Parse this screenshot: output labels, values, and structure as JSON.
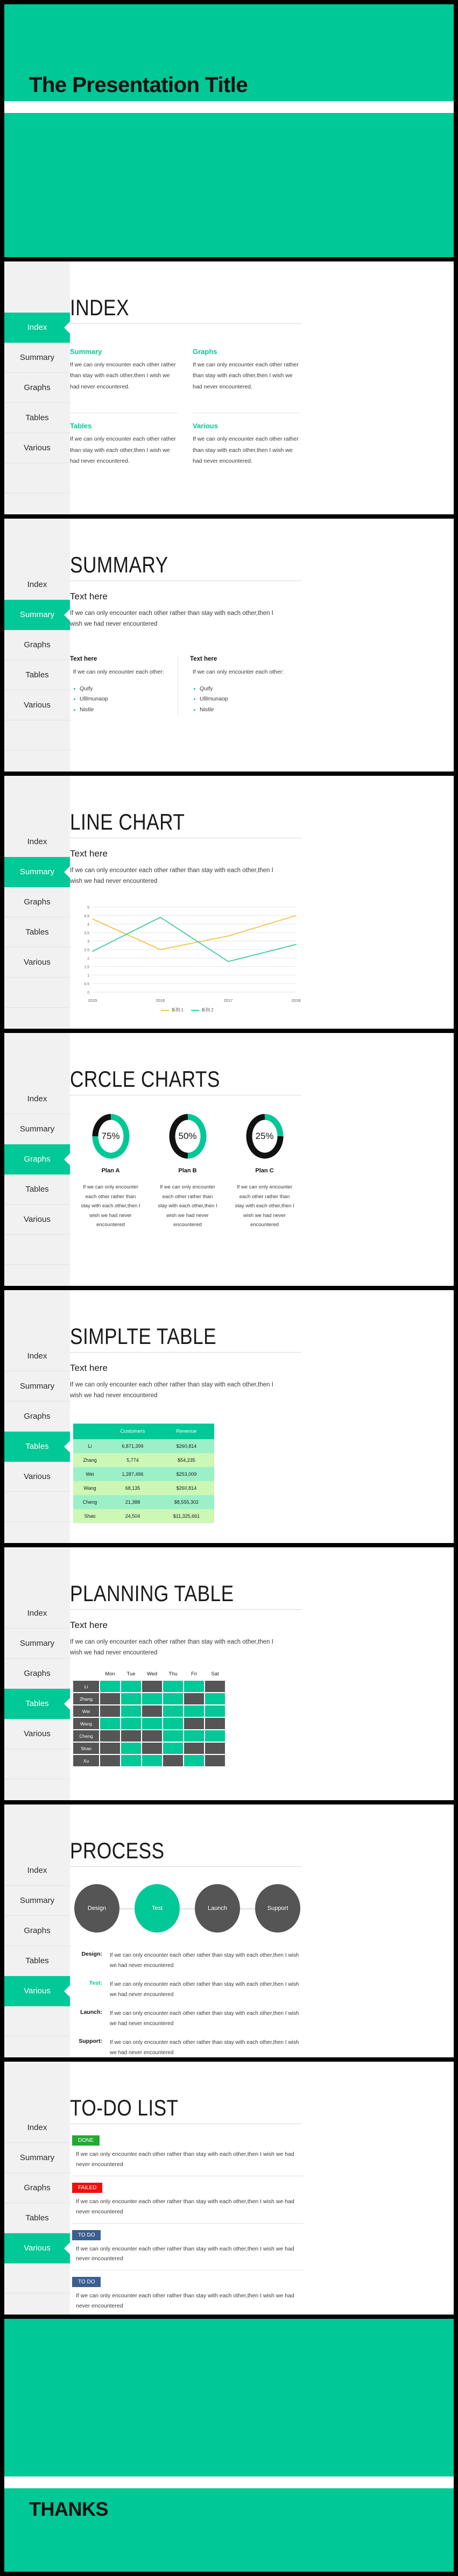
{
  "theme": {
    "accent": "#00c896",
    "dark_gray": "#555555",
    "sidebar_bg": "#f1f1f1",
    "done_green": "#22aa33",
    "failed_red": "#ee1111",
    "todo_blue": "#3b5f8f",
    "series1_color": "#f2c14e",
    "series2_color": "#3fc9a3"
  },
  "lorem": "If we can only encounter each other rather than stay with each other,then I wish we had never encountered",
  "lorem_short": "If we can only encounter each other rather than stay with each other,then I wish we had never encountered.",
  "nav": {
    "items": [
      "Index",
      "Summary",
      "Graphs",
      "Tables",
      "Various"
    ]
  },
  "cover": {
    "title": "The Presentation Title"
  },
  "closing": {
    "title": "THANKS"
  },
  "index": {
    "title": "INDEX",
    "cards": [
      {
        "heading": "Summary",
        "text": "If we can only encounter each other rather than stay with each other,then I wish we had never encountered."
      },
      {
        "heading": "Graphs",
        "text": "If we can only encounter each other rather than stay with each other,then I wish we had never encountered."
      },
      {
        "heading": "Tables",
        "text": "If we can only encounter each other rather than stay with each other,then I wish we had never encountered."
      },
      {
        "heading": "Various",
        "text": "If we can only encounter each other rather than stay with each other,then I wish we had never encountered."
      }
    ]
  },
  "summary": {
    "title": "SUMMARY",
    "sub": "Text here",
    "para": "If we can only encounter each other rather than stay with each other,then I wish we had never encountered",
    "columns": [
      {
        "heading": "Text here",
        "text": "If we can only encounter each other:",
        "bullets": [
          "Quify",
          "Ulllmunaop",
          "Nistle"
        ]
      },
      {
        "heading": "Text here",
        "text": "If we can only encounter each other:",
        "bullets": [
          "Quify",
          "Ulllmunaop",
          "Nistle"
        ]
      }
    ]
  },
  "line_chart_slide": {
    "title": "LINE CHART",
    "sub": "Text here",
    "para": "If we can only encounter each other rather than stay with each other,then I wish we had never encountered"
  },
  "circle_slide": {
    "title": "CRCLE CHARTS",
    "cards": [
      {
        "label": "Plan A",
        "percent": "75%",
        "value": 75,
        "text": "If we can only encounter each other rather than stay with each other,then I wish we had never encountered"
      },
      {
        "label": "Plan B",
        "percent": "50%",
        "value": 50,
        "text": "If we can only encounter each other rather than stay with each other,then I wish we had never encountered"
      },
      {
        "label": "Plan C",
        "percent": "25%",
        "value": 25,
        "text": "If we can only encounter each other rather than stay with each other,then I wish we had never encountered"
      }
    ]
  },
  "simple_table": {
    "title": "SIMPLTE TABLE",
    "sub": "Text here",
    "para": "If we can only encounter each other rather than stay with each other,then I wish we had never encountered",
    "headers": [
      "",
      "Customers",
      "Revenue"
    ],
    "rows": [
      [
        "Li",
        "6,871,399",
        "$260,814"
      ],
      [
        "Zhang",
        "5,774",
        "$54,235"
      ],
      [
        "Wei",
        "1,287,496",
        "$253,009"
      ],
      [
        "Wang",
        "68,135",
        "$260,814"
      ],
      [
        "Cheng",
        "21,388",
        "$8,555,302"
      ],
      [
        "Shao",
        "24,504",
        "$11,325,661"
      ]
    ]
  },
  "planning_table": {
    "title": "PLANNING TABLE",
    "sub": "Text here",
    "para": "If we can only encounter each other rather than stay with each other,then I wish we had never encountered",
    "days": [
      "Mon",
      "Tue",
      "Wed",
      "Thu",
      "Fri",
      "Sat"
    ],
    "rows": [
      {
        "name": "Li",
        "cells": [
          1,
          1,
          0,
          1,
          1,
          0
        ]
      },
      {
        "name": "Zhang",
        "cells": [
          0,
          1,
          1,
          1,
          0,
          1
        ]
      },
      {
        "name": "Wei",
        "cells": [
          0,
          1,
          0,
          1,
          1,
          1
        ]
      },
      {
        "name": "Wang",
        "cells": [
          1,
          1,
          1,
          1,
          0,
          0
        ]
      },
      {
        "name": "Cheng",
        "cells": [
          0,
          0,
          0,
          1,
          1,
          1
        ]
      },
      {
        "name": "Shao",
        "cells": [
          0,
          1,
          0,
          1,
          0,
          0
        ]
      },
      {
        "name": "Xu",
        "cells": [
          0,
          1,
          1,
          0,
          1,
          0
        ]
      }
    ]
  },
  "process": {
    "title": "PROCESS",
    "steps": [
      {
        "label": "Design",
        "active": false
      },
      {
        "label": "Test",
        "active": true
      },
      {
        "label": "Launch",
        "active": false
      },
      {
        "label": "Support",
        "active": false
      }
    ],
    "rows": [
      {
        "key": "Design:",
        "active": false,
        "text": "If we can only encounter each other rather than stay with each other,then I wish we had never encountered"
      },
      {
        "key": "Test:",
        "active": true,
        "text": "If we can only encounter each other rather than stay with each other,then I wish we had never encountered"
      },
      {
        "key": "Launch:",
        "active": false,
        "text": "If we can only encounter each other rather than stay with each other,then I wish we had never encountered"
      },
      {
        "key": "Support:",
        "active": false,
        "text": "If we can only encounter each other rather than stay with each other,then I wish we had never encountered"
      }
    ]
  },
  "todo": {
    "title": "TO-DO LIST",
    "items": [
      {
        "badge": "DONE",
        "color": "#22aa33",
        "text": "If we can only encounter each other rather than stay with each other,then I wish we had never encountered"
      },
      {
        "badge": "FAILED",
        "color": "#ee1111",
        "text": "If we can only encounter each other rather than stay with each other,then I wish we had never encountered"
      },
      {
        "badge": "TO DO",
        "color": "#3b5f8f",
        "text": "If we can only encounter each other rather than stay with each other,then I wish we had never encountered"
      },
      {
        "badge": "TO DO",
        "color": "#3b5f8f",
        "text": "If we can only encounter each other rather than stay with each other,then I wish we had never encountered"
      }
    ]
  },
  "chart_data": {
    "type": "line",
    "title": "",
    "xlabel": "",
    "ylabel": "",
    "x": [
      "2015",
      "2016",
      "2017",
      "2018"
    ],
    "ylim": [
      0,
      5
    ],
    "yticks": [
      "0",
      "0.5",
      "1",
      "1.5",
      "2",
      "2.5",
      "3",
      "3.5",
      "4",
      "4.5",
      "5"
    ],
    "grid": true,
    "legend_position": "bottom",
    "series": [
      {
        "name": "系列 1",
        "color": "#f2c14e",
        "values": [
          4.3,
          2.5,
          3.3,
          4.5
        ]
      },
      {
        "name": "系列 2",
        "color": "#3fc9a3",
        "values": [
          2.4,
          4.4,
          1.8,
          2.8
        ]
      }
    ]
  }
}
